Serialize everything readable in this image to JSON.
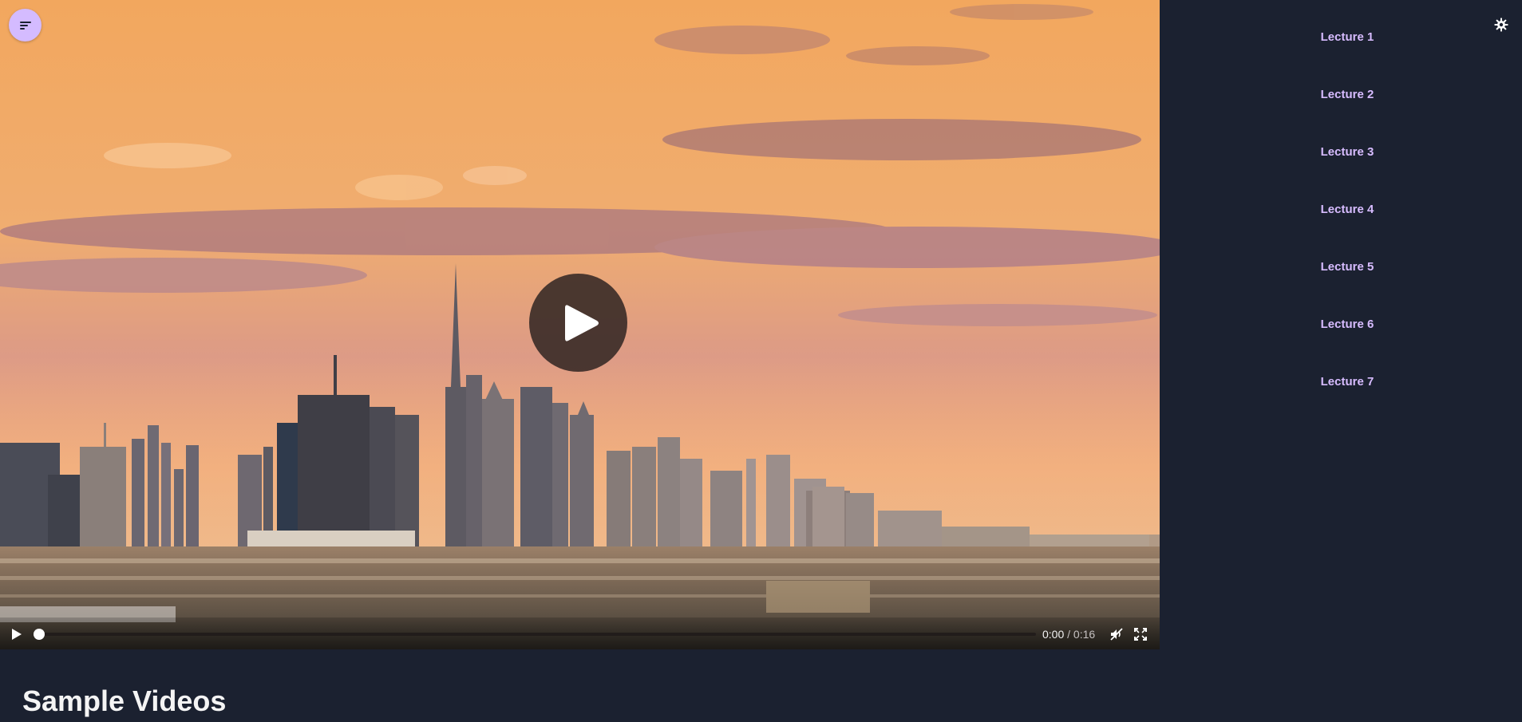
{
  "player": {
    "current_time": "0:00",
    "separator": "/",
    "duration": "0:16",
    "progress": 0,
    "muted": true
  },
  "sidebar": {
    "lectures": [
      {
        "label": "Lecture 1"
      },
      {
        "label": "Lecture 2"
      },
      {
        "label": "Lecture 3"
      },
      {
        "label": "Lecture 4"
      },
      {
        "label": "Lecture 5"
      },
      {
        "label": "Lecture 6"
      },
      {
        "label": "Lecture 7"
      }
    ]
  },
  "main": {
    "title": "Sample Videos"
  },
  "colors": {
    "background": "#1b2130",
    "accent": "#d7bcff",
    "menu_button": "#d4bbff"
  },
  "icons": {
    "menu": "menu-icon",
    "play": "play-icon",
    "mute": "muted-icon",
    "fullscreen": "fullscreen-icon",
    "settings": "settings-icon"
  }
}
